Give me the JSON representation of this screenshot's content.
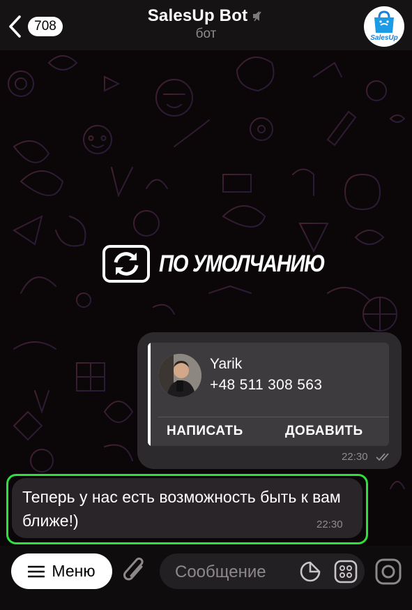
{
  "header": {
    "unread_count": "708",
    "title": "SalesUp Bot",
    "subtitle": "бот",
    "avatar_text": "SalesUp"
  },
  "stamp": {
    "text": "ПО УМОЛЧАНИЮ"
  },
  "contact_message": {
    "name": "Yarik",
    "phone": "+48 511 308 563",
    "write_label": "НАПИСАТЬ",
    "add_label": "ДОБАВИТЬ",
    "time": "22:30"
  },
  "incoming_message": {
    "text": "Теперь у нас есть возможность быть к вам ближе!)",
    "time": "22:30"
  },
  "composer": {
    "menu_label": "Меню",
    "placeholder": "Сообщение"
  },
  "colors": {
    "highlight": "#2ee03a",
    "avatar_brand": "#1b7fd8"
  },
  "icons": [
    "back-chevron-icon",
    "mute-icon",
    "salesup-bag-icon",
    "refresh-icon",
    "read-ticks-icon",
    "menu-burger-icon",
    "paperclip-icon",
    "sticker-icon",
    "emoji-grid-icon",
    "camera-icon"
  ]
}
